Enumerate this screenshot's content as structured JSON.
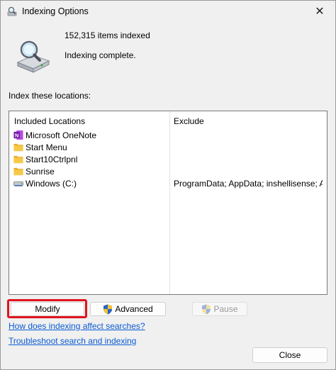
{
  "window": {
    "title": "Indexing Options"
  },
  "status": {
    "items_indexed": "152,315 items indexed",
    "state": "Indexing complete."
  },
  "locations": {
    "label": "Index these locations:",
    "headers": {
      "included": "Included Locations",
      "exclude": "Exclude"
    },
    "rows": [
      {
        "name": "Microsoft OneNote",
        "exclude": "",
        "icon": "onenote-icon"
      },
      {
        "name": "Start Menu",
        "exclude": "",
        "icon": "folder-icon"
      },
      {
        "name": "Start10Ctrlpnl",
        "exclude": "",
        "icon": "folder-icon"
      },
      {
        "name": "Sunrise",
        "exclude": "",
        "icon": "folder-icon"
      },
      {
        "name": "Windows (C:)",
        "exclude": "ProgramData; AppData; inshellisense; App...",
        "icon": "drive-icon"
      }
    ]
  },
  "buttons": {
    "modify": "Modify",
    "advanced": "Advanced",
    "pause": "Pause",
    "close": "Close"
  },
  "links": {
    "how_indexing": "How does indexing affect searches?",
    "troubleshoot": "Troubleshoot search and indexing"
  },
  "colors": {
    "highlight": "#e0141e",
    "link": "#0a5bd1",
    "onenote": "#7719aa",
    "folder": "#f7c948"
  }
}
